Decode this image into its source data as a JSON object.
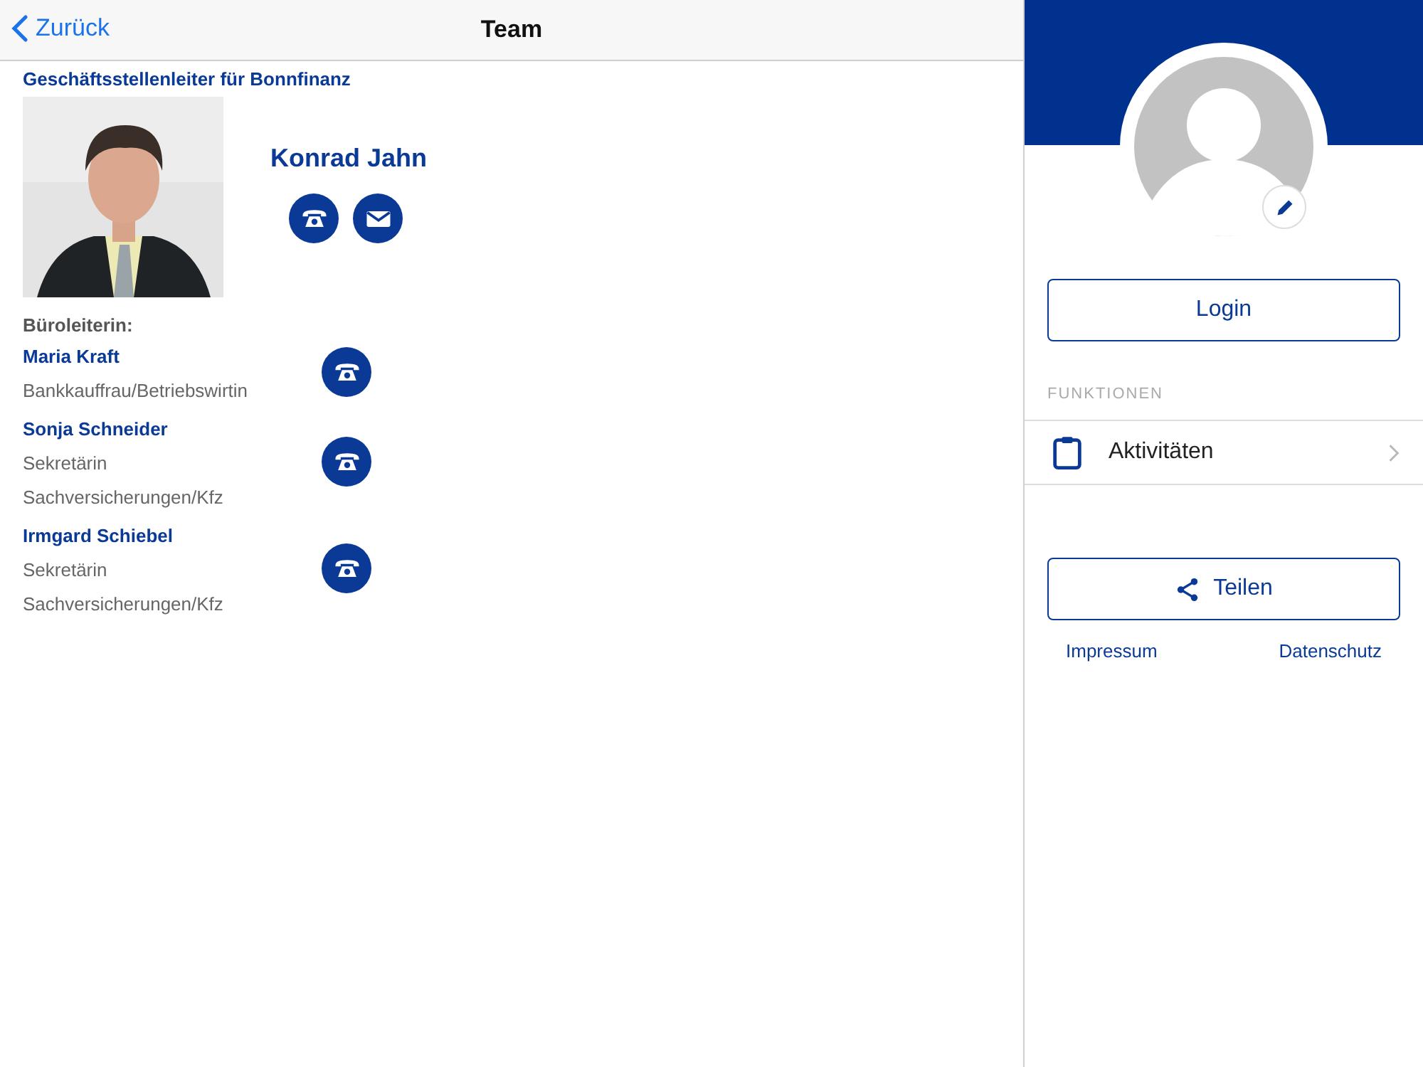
{
  "nav": {
    "back": "Zurück",
    "title": "Team"
  },
  "leader": {
    "heading": "Geschäftsstellenleiter für Bonnfinanz",
    "name": "Konrad Jahn"
  },
  "office_heading": "Büroleiterin:",
  "staff": [
    {
      "name": "Maria Kraft",
      "lines": [
        "Bankkauffrau/Betriebswirtin"
      ]
    },
    {
      "name": "Sonja Schneider",
      "lines": [
        "Sekretärin",
        "Sachversicherungen/Kfz"
      ]
    },
    {
      "name": "Irmgard Schiebel",
      "lines": [
        "Sekretärin",
        "Sachversicherungen/Kfz"
      ]
    }
  ],
  "sidebar": {
    "login": "Login",
    "section": "FUNKTIONEN",
    "items": [
      {
        "label": "Aktivitäten"
      }
    ],
    "share": "Teilen",
    "links": [
      "Impressum",
      "Datenschutz"
    ]
  }
}
